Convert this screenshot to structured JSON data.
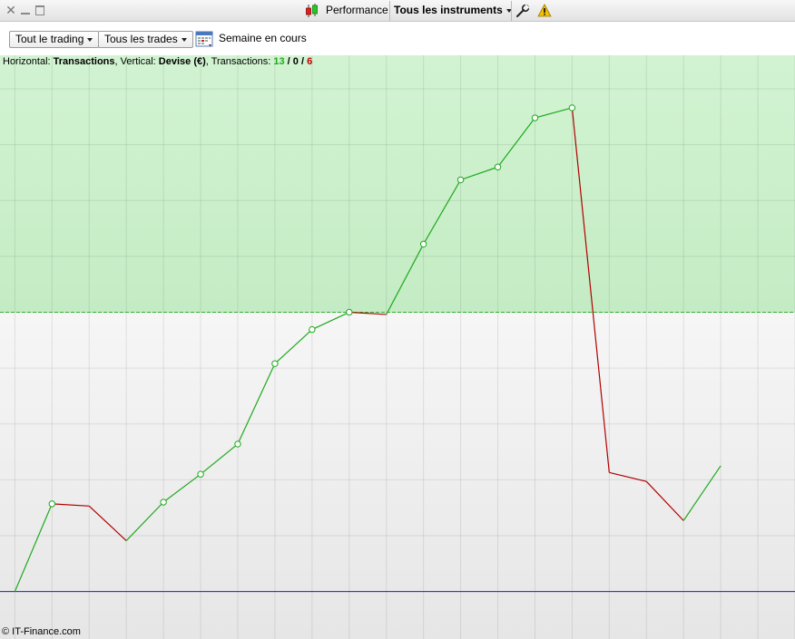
{
  "toolbar": {
    "performance_label": "Performance",
    "instruments_label": "Tous les instruments",
    "icons": [
      "close-icon",
      "minimize-icon",
      "maximize-icon",
      "candlestick-icon",
      "wrench-icon",
      "warning-icon",
      "calendar-icon"
    ]
  },
  "filters": {
    "trading_label": "Tout le trading",
    "trades_label": "Tous les trades",
    "period_label": "Semaine en cours"
  },
  "info": {
    "h_prefix": "Horizontal: ",
    "h_value": "Transactions",
    "v_prefix": ", Vertical: ",
    "v_value": "Devise (€)",
    "t_prefix": ", Transactions: ",
    "wins": "13",
    "slash1": " / ",
    "neutral": "0",
    "slash2": " / ",
    "losses": "6"
  },
  "footer": {
    "copyright": "© IT-Finance.com"
  },
  "colors": {
    "win": "#1eaa1e",
    "loss": "#b00000",
    "zero_line": "#2020a0",
    "profit_zone": "#c6efc6"
  },
  "chart_data": {
    "type": "line",
    "title": "",
    "xlabel": "Transactions",
    "ylabel": "Devise (€)",
    "x": [
      0,
      1,
      2,
      3,
      4,
      5,
      6,
      7,
      8,
      9,
      10,
      11,
      12,
      13,
      14,
      15,
      16,
      17,
      18,
      19
    ],
    "y": [
      0,
      1.57,
      1.53,
      0.91,
      1.6,
      2.1,
      2.64,
      4.08,
      4.69,
      5.0,
      4.96,
      6.22,
      7.37,
      7.6,
      8.48,
      8.66,
      2.13,
      1.97,
      1.27,
      2.25
    ],
    "results": [
      "start",
      "win",
      "loss",
      "loss",
      "win",
      "win",
      "win",
      "win",
      "win",
      "win",
      "loss",
      "win",
      "win",
      "win",
      "win",
      "win",
      "loss",
      "loss",
      "loss",
      "win"
    ],
    "threshold": 5.0,
    "ylim": [
      -0.85,
      9.6
    ],
    "xlim": [
      -0.4,
      21
    ]
  }
}
